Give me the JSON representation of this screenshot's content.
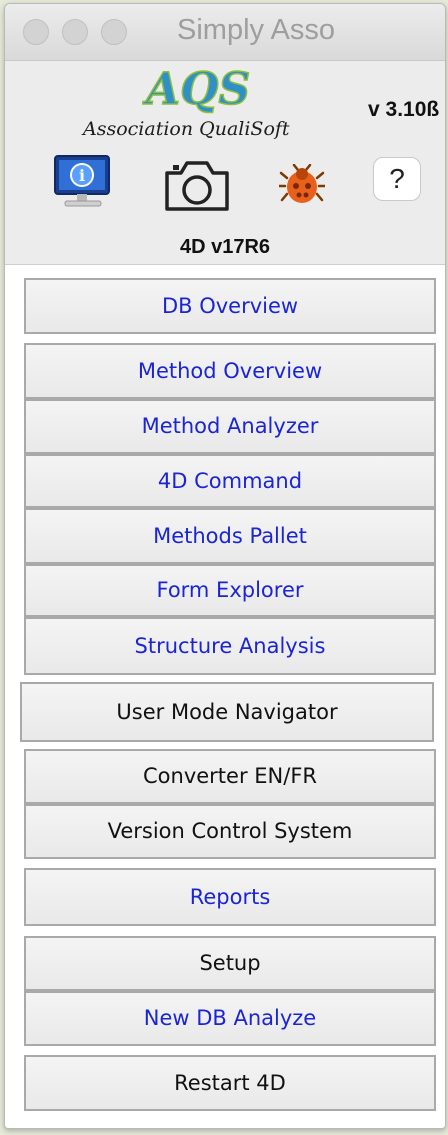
{
  "window": {
    "title": "Simply Asso"
  },
  "header": {
    "logo_text": "AQS",
    "logo_subtitle": "Association QualiSoft",
    "version": "v 3.10ß",
    "db_version": "4D v17R6",
    "icons": [
      "info-monitor-icon",
      "camera-icon",
      "bug-icon",
      "help-icon"
    ],
    "help_label": "?"
  },
  "colors": {
    "link_blue": "#1b25d6",
    "text_black": "#111111",
    "button_border": "#a9a9a9"
  },
  "menu": {
    "db_overview": "DB Overview",
    "method_overview": "Method Overview",
    "method_analyzer": "Method Analyzer",
    "command_4d": "4D Command",
    "methods_pallet": "Methods Pallet",
    "form_explorer": "Form Explorer",
    "structure_analysis": "Structure Analysis",
    "user_mode_navigator": "User Mode Navigator",
    "converter": "Converter EN/FR",
    "version_control": "Version Control System",
    "reports": "Reports",
    "setup": "Setup",
    "new_db_analyze": "New DB Analyze",
    "restart_4d": "Restart 4D"
  }
}
